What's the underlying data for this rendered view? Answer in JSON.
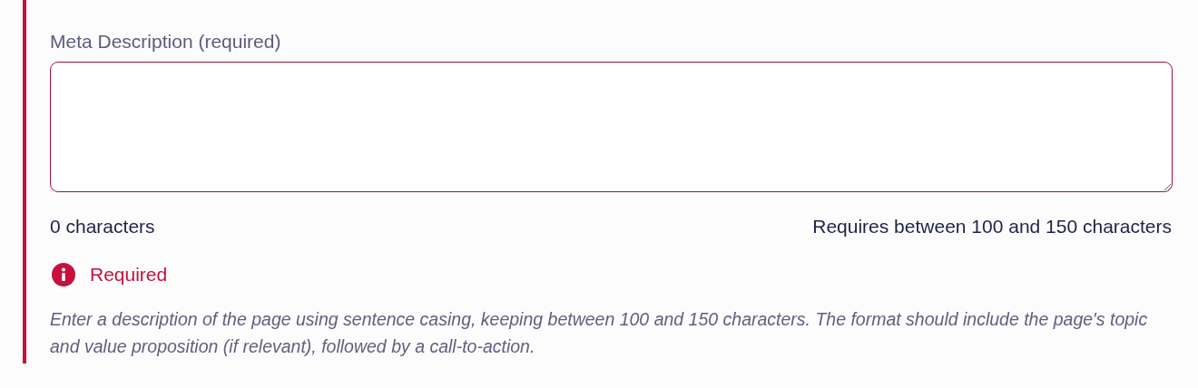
{
  "field": {
    "label": "Meta Description (required)",
    "invalid": true,
    "character_count": "0 characters",
    "requirement": "Requires between 100 and 150 characters",
    "error_message": "Required",
    "help_text": "Enter a description of the page using sentence casing, keeping between 100 and 150 characters. The format should include the page's topic and value proposition (if relevant), followed by a call-to-action."
  }
}
